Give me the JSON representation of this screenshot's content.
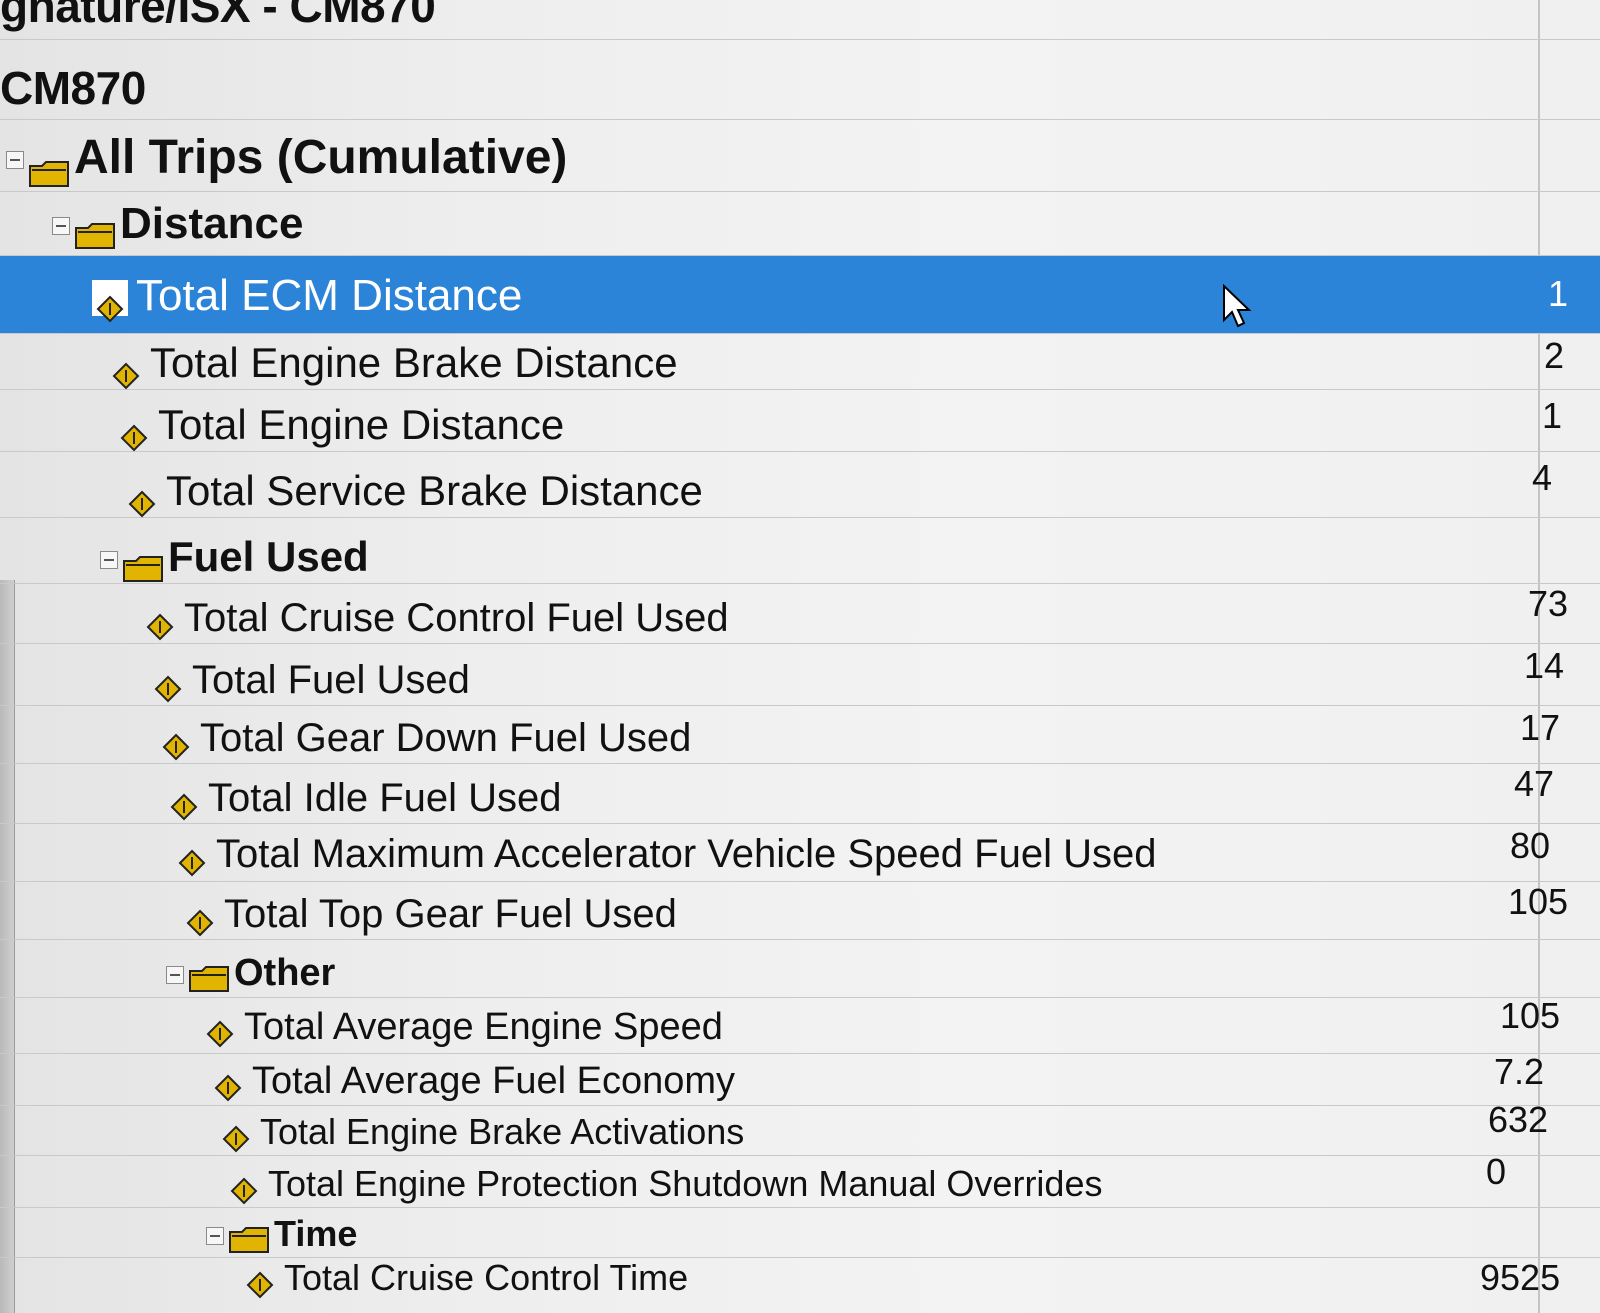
{
  "window": {
    "title_partial": "gnature/ISX - CM870",
    "subtitle": "CM870"
  },
  "tree": {
    "root": {
      "label": "All Trips (Cumulative)"
    },
    "groups": [
      {
        "label": "Distance",
        "items": [
          {
            "label": "Total ECM Distance",
            "value": "1",
            "selected": true
          },
          {
            "label": "Total Engine Brake Distance",
            "value": "2"
          },
          {
            "label": "Total Engine Distance",
            "value": "1"
          },
          {
            "label": "Total Service Brake Distance",
            "value": "4"
          }
        ]
      },
      {
        "label": "Fuel Used",
        "items": [
          {
            "label": "Total Cruise Control Fuel Used",
            "value": "73"
          },
          {
            "label": "Total Fuel Used",
            "value": "14"
          },
          {
            "label": "Total Gear Down Fuel Used",
            "value": "17"
          },
          {
            "label": "Total Idle Fuel Used",
            "value": "47"
          },
          {
            "label": "Total Maximum Accelerator Vehicle Speed Fuel Used",
            "value": "80"
          },
          {
            "label": "Total Top Gear Fuel Used",
            "value": "105"
          }
        ]
      },
      {
        "label": "Other",
        "items": [
          {
            "label": "Total Average Engine Speed",
            "value": "105"
          },
          {
            "label": "Total Average Fuel Economy",
            "value": "7.2"
          },
          {
            "label": "Total Engine Brake Activations",
            "value": "632"
          },
          {
            "label": "Total Engine Protection Shutdown Manual Overrides",
            "value": "0"
          }
        ]
      },
      {
        "label": "Time",
        "items": [
          {
            "label": "Total Cruise Control Time",
            "value": "9525"
          }
        ]
      }
    ]
  },
  "icons": {
    "expander": "collapse-box-icon",
    "group": "folder-icon",
    "parameter": "parameter-diamond-icon",
    "cursor": "mouse-pointer-icon"
  },
  "colors": {
    "selection": "#2b84d8",
    "icon_fill": "#e0b400"
  }
}
